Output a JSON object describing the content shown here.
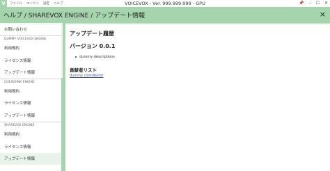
{
  "window": {
    "logo_letter": "V",
    "menu": [
      "ファイル",
      "エンジン",
      "設定",
      "ヘルプ"
    ],
    "title": "VOICEVOX - Ver. 999.999.999 - GPU",
    "controls": {
      "pin": "📌",
      "minimize": "–",
      "maximize": "☐",
      "close": "✕"
    }
  },
  "header": {
    "title": "ヘルプ / SHAREVOX ENGINE / アップデート情報",
    "close_icon": "×"
  },
  "sidebar": {
    "top_item": "お問い合わせ",
    "groups": [
      {
        "caption": "DUMMY VOICEVOX ENGINE",
        "items": [
          "利用規約",
          "ライセンス情報",
          "アップデート情報"
        ]
      },
      {
        "caption": "COEIROINK ENGINE",
        "items": [
          "利用規約",
          "ライセンス情報",
          "アップデート情報"
        ]
      },
      {
        "caption": "SHAREVOX ENGINE",
        "items": [
          "利用規約",
          "ライセンス情報",
          "アップデート情報"
        ]
      }
    ]
  },
  "main": {
    "heading": "アップデート履歴",
    "version_label": "バージョン 0.0.1",
    "description": "dummy descriptions",
    "contributors_heading": "貢献者リスト",
    "contributor": "dummy contributor"
  },
  "colors": {
    "accent": "#a5d4ad",
    "active_item_bg": "#e8f3ea",
    "link": "#2a55c9"
  }
}
